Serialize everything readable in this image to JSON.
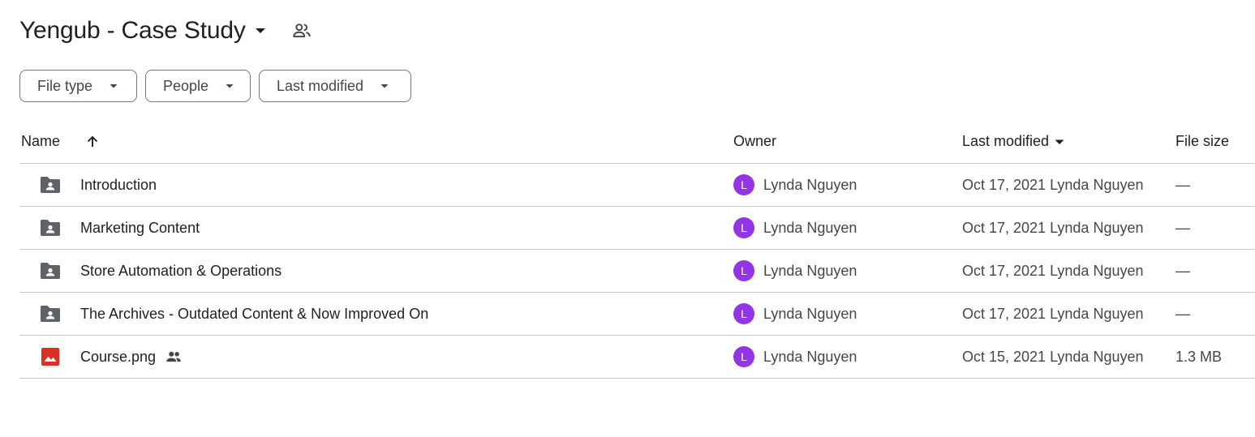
{
  "header": {
    "title": "Yengub - Case Study",
    "caret_icon": "arrow-drop-down-icon",
    "shared_icon": "shared-people-icon"
  },
  "filters": [
    {
      "label": "File type",
      "icon": "arrow-drop-down-icon"
    },
    {
      "label": "People",
      "icon": "arrow-drop-down-icon"
    },
    {
      "label": "Last modified",
      "icon": "arrow-drop-down-icon"
    }
  ],
  "table": {
    "columns": {
      "name": "Name",
      "owner": "Owner",
      "last_modified": "Last modified",
      "file_size": "File size"
    },
    "sort_icon": "arrow-upward-icon",
    "rows": [
      {
        "icon": "shared-folder-icon",
        "name": "Introduction",
        "owner_initial": "L",
        "owner": "Lynda Nguyen",
        "modified": "Oct 17, 2021 Lynda Nguyen",
        "size": "—"
      },
      {
        "icon": "shared-folder-icon",
        "name": "Marketing Content",
        "owner_initial": "L",
        "owner": "Lynda Nguyen",
        "modified": "Oct 17, 2021 Lynda Nguyen",
        "size": "—"
      },
      {
        "icon": "shared-folder-icon",
        "name": "Store Automation & Operations",
        "owner_initial": "L",
        "owner": "Lynda Nguyen",
        "modified": "Oct 17, 2021 Lynda Nguyen",
        "size": "—"
      },
      {
        "icon": "shared-folder-icon",
        "name": "The Archives - Outdated Content & Now Improved On",
        "owner_initial": "L",
        "owner": "Lynda Nguyen",
        "modified": "Oct 17, 2021 Lynda Nguyen",
        "size": "—"
      },
      {
        "icon": "image-file-icon",
        "name": "Course.png",
        "owner_initial": "L",
        "owner": "Lynda Nguyen",
        "modified": "Oct 15, 2021 Lynda Nguyen",
        "size": "1.3 MB",
        "shared": true
      }
    ]
  },
  "colors": {
    "avatar": "#9334e6",
    "image_icon": "#d93025",
    "folder_icon": "#5f6368",
    "divider": "#c7c7c7"
  }
}
